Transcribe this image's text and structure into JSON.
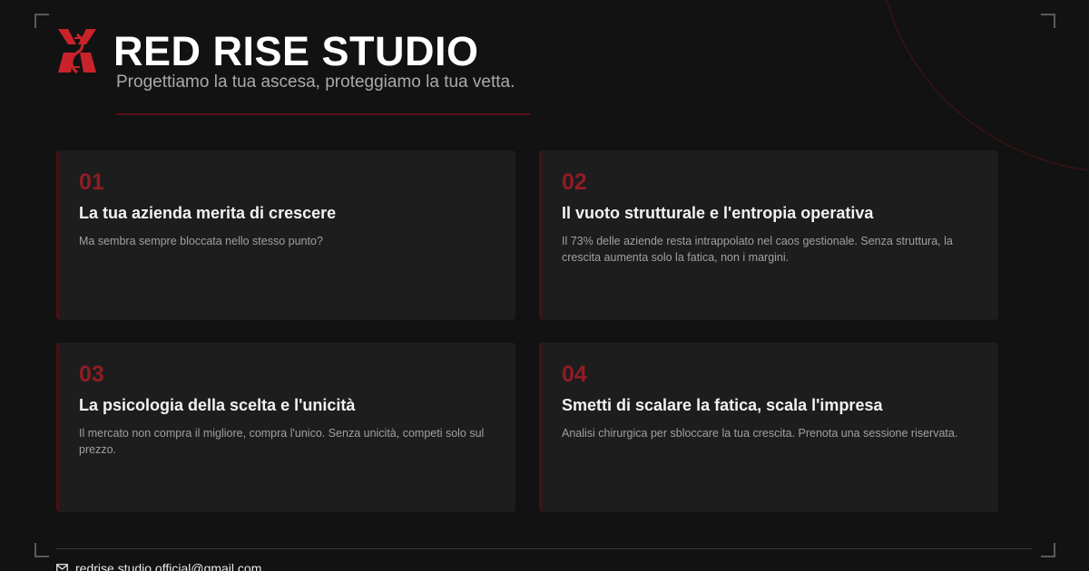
{
  "brand": {
    "title": "RED RISE STUDIO",
    "tagline": "Progettiamo la tua ascesa, proteggiamo la tua vetta.",
    "logo_icon": "red-rise-monogram",
    "accent_color": "#8f1d24"
  },
  "cards": [
    {
      "number": "01",
      "title": "La tua azienda merita di crescere",
      "description": "Ma sembra sempre bloccata nello stesso punto?"
    },
    {
      "number": "02",
      "title": "Il vuoto strutturale e l'entropia operativa",
      "description": "Il 73% delle aziende resta intrappolato nel caos gestionale. Senza struttura, la crescita aumenta solo la fatica, non i margini."
    },
    {
      "number": "03",
      "title": "La psicologia della scelta e l'unicità",
      "description": "Il mercato non compra il migliore, compra l'unico. Senza unicità, competi solo sul prezzo."
    },
    {
      "number": "04",
      "title": "Smetti di scalare la fatica, scala l'impresa",
      "description": "Analisi chirurgica per sbloccare la tua crescita. Prenota una sessione riservata."
    }
  ],
  "footer": {
    "email_icon": "mail-icon",
    "email": "redrise.studio.official@gmail.com"
  }
}
